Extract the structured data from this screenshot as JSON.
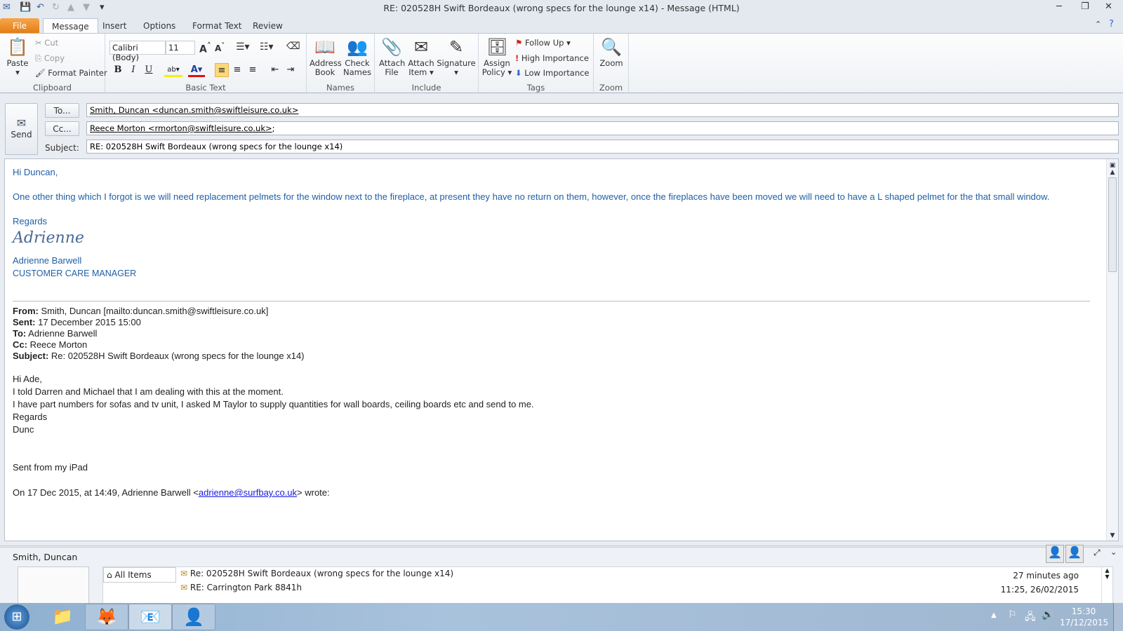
{
  "window": {
    "title": "RE: 020528H Swift Bordeaux (wrong specs for the lounge x14)  -  Message (HTML)"
  },
  "tabs": [
    "File",
    "Message",
    "Insert",
    "Options",
    "Format Text",
    "Review"
  ],
  "ribbon": {
    "clipboard": {
      "label": "Clipboard",
      "paste": "Paste",
      "cut": "Cut",
      "copy": "Copy",
      "format_painter": "Format Painter"
    },
    "basic_text": {
      "label": "Basic Text",
      "font": "Calibri (Body)",
      "size": "11",
      "bold": "B",
      "italic": "I",
      "underline": "U"
    },
    "names": {
      "label": "Names",
      "address_book": "Address Book",
      "check_names": "Check Names"
    },
    "include": {
      "label": "Include",
      "attach_file": "Attach File",
      "attach_item": "Attach Item",
      "signature": "Signature"
    },
    "tags": {
      "label": "Tags",
      "assign_policy": "Assign Policy",
      "follow_up": "Follow Up",
      "high": "High Importance",
      "low": "Low Importance"
    },
    "zoom": {
      "label": "Zoom",
      "zoom": "Zoom"
    }
  },
  "header": {
    "send": "Send",
    "to_btn": "To...",
    "cc_btn": "Cc...",
    "subject_label": "Subject:",
    "to": "Smith, Duncan <duncan.smith@swiftleisure.co.uk>",
    "cc": "Reece Morton <rmorton@swiftleisure.co.uk>",
    "cc_suffix": ";",
    "subject": "RE: 020528H Swift Bordeaux (wrong specs for the lounge x14)"
  },
  "message": {
    "greeting": "Hi Duncan,",
    "para": "One other thing which I forgot is we will need replacement pelmets for the window next to the fireplace, at present they have no return on them, however, once the fireplaces have been moved we will need to have a L shaped pelmet for the that small window.",
    "regards": "Regards",
    "signature_script": "Adrienne",
    "sig_name": "Adrienne Barwell",
    "sig_title": "CUSTOMER CARE MANAGER",
    "quoted": {
      "from_label": "From:",
      "from": " Smith, Duncan [mailto:duncan.smith@swiftleisure.co.uk]",
      "sent_label": "Sent:",
      "sent": " 17 December 2015 15:00",
      "to_label": "To:",
      "to": " Adrienne Barwell",
      "cc_label": "Cc:",
      "cc": " Reece Morton",
      "subject_label": "Subject:",
      "subject": " Re: 020528H Swift Bordeaux (wrong specs for the lounge x14)"
    },
    "reply_lines": [
      "Hi Ade,",
      "I told Darren and Michael that I am dealing with this at the moment.",
      "I have part numbers for sofas and tv unit, I asked M Taylor to supply quantities for wall boards, ceiling boards etc and send to me.",
      "Regards",
      "Dunc"
    ],
    "sent_from": "Sent from my iPad",
    "wrote_prefix": "On 17 Dec 2015, at 14:49, Adrienne Barwell <",
    "wrote_email": "adrienne@surfbay.co.uk",
    "wrote_suffix": "> wrote:"
  },
  "people_pane": {
    "name": "Smith, Duncan",
    "filters": [
      "All Items"
    ],
    "items": [
      {
        "subject": "Re: 020528H Swift Bordeaux (wrong specs for the lounge x14)",
        "time": "27 minutes ago"
      },
      {
        "subject": "RE: Carrington Park 8841h",
        "time": "11:25, 26/02/2015"
      }
    ]
  },
  "taskbar": {
    "time": "15:30",
    "date": "17/12/2015"
  }
}
